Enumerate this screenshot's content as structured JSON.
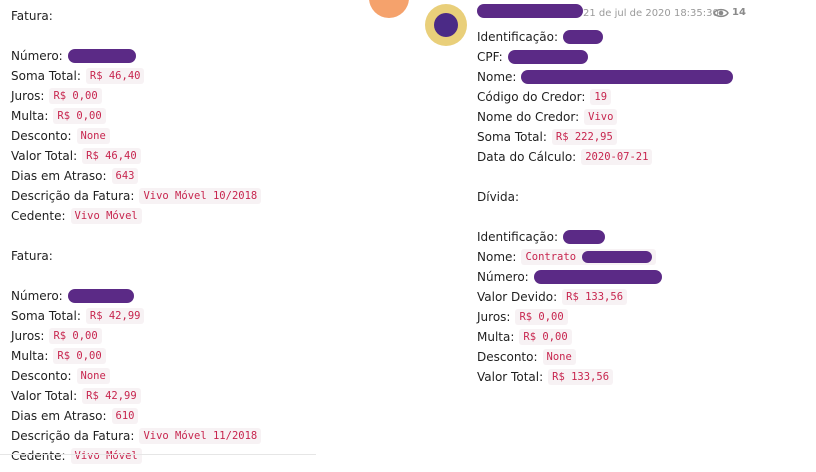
{
  "left": {
    "invoice1": {
      "heading": "Fatura:",
      "numero_label": "Número:",
      "soma_label": "Soma Total:",
      "soma": "R$ 46,40",
      "juros_label": "Juros:",
      "juros": "R$ 0,00",
      "multa_label": "Multa:",
      "multa": "R$ 0,00",
      "desconto_label": "Desconto:",
      "desconto": "None",
      "valor_label": "Valor Total:",
      "valor": "R$ 46,40",
      "dias_label": "Dias em Atraso:",
      "dias": "643",
      "descricao_label": "Descrição da Fatura:",
      "descricao": "Vivo Móvel 10/2018",
      "cedente_label": "Cedente:",
      "cedente": "Vivo Móvel"
    },
    "invoice2": {
      "heading": "Fatura:",
      "numero_label": "Número:",
      "soma_label": "Soma Total:",
      "soma": "R$ 42,99",
      "juros_label": "Juros:",
      "juros": "R$ 0,00",
      "multa_label": "Multa:",
      "multa": "R$ 0,00",
      "desconto_label": "Desconto:",
      "desconto": "None",
      "valor_label": "Valor Total:",
      "valor": "R$ 42,99",
      "dias_label": "Dias em Atraso:",
      "dias": "610",
      "descricao_label": "Descrição da Fatura:",
      "descricao": "Vivo Móvel 11/2018",
      "cedente_label": "Cedente:",
      "cedente": "Vivo Móvel"
    }
  },
  "message_header": {
    "timestamp": "21 de jul de 2020 18:35:30",
    "views": "14",
    "icon": "eye-icon"
  },
  "right": {
    "identificacao_label": "Identificação:",
    "cpf_label": "CPF:",
    "nome_label": "Nome:",
    "codigo_label": "Código do Credor:",
    "codigo": "19",
    "credor_label": "Nome do Credor:",
    "credor": "Vivo",
    "soma_label": "Soma Total:",
    "soma": "R$ 222,95",
    "data_label": "Data do Cálculo:",
    "data": "2020-07-21",
    "divida": {
      "heading": "Dívida:",
      "identificacao_label": "Identificação:",
      "nome_label": "Nome:",
      "nome_prefix": "Contrato",
      "numero_label": "Número:",
      "valor_devido_label": "Valor Devido:",
      "valor_devido": "R$ 133,56",
      "juros_label": "Juros:",
      "juros": "R$ 0,00",
      "multa_label": "Multa:",
      "multa": "R$ 0,00",
      "desconto_label": "Desconto:",
      "desconto": "None",
      "valor_total_label": "Valor Total:",
      "valor_total": "R$ 133,56"
    }
  },
  "colors": {
    "code_text": "#c7254e",
    "code_bg": "#f7f2f4",
    "redaction": "#5b2a86",
    "avatar_ring": "#e9cf7a"
  }
}
